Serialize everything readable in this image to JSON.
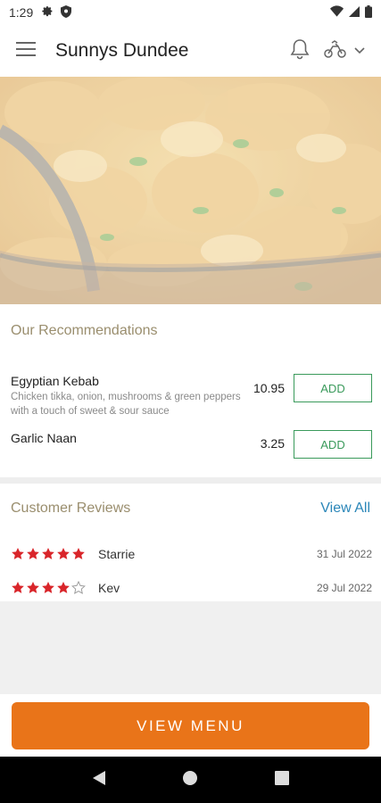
{
  "status": {
    "time": "1:29"
  },
  "header": {
    "title": "Sunnys Dundee"
  },
  "recommendations": {
    "title": "Our Recommendations",
    "items": [
      {
        "name": "Egyptian Kebab",
        "description": "Chicken tikka, onion, mushrooms & green peppers with a touch of sweet & sour sauce",
        "price": "10.95",
        "button": "ADD"
      },
      {
        "name": "Garlic Naan",
        "description": "",
        "price": "3.25",
        "button": "ADD"
      }
    ]
  },
  "reviews": {
    "title": "Customer Reviews",
    "view_all": "View All",
    "items": [
      {
        "name": "Starrie",
        "date": "31 Jul 2022",
        "rating": 5
      },
      {
        "name": "Kev",
        "date": "29 Jul 2022",
        "rating": 4
      }
    ]
  },
  "footer": {
    "button": "VIEW MENU"
  },
  "colors": {
    "accent": "#e97419",
    "add_green": "#3a9a5b",
    "link_blue": "#2a86b8",
    "star_red": "#d9252a",
    "section_title": "#9a8e6e"
  }
}
